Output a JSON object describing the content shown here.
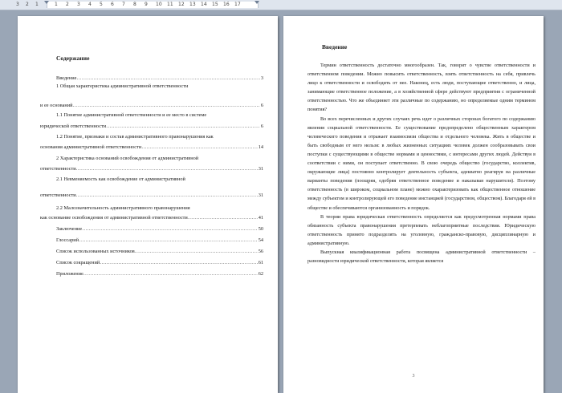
{
  "ruler": {
    "numbers": [
      "3",
      "2",
      "1",
      "1",
      "2",
      "3",
      "4",
      "5",
      "6",
      "7",
      "8",
      "9",
      "10",
      "11",
      "12",
      "13",
      "14",
      "15",
      "16",
      "17"
    ]
  },
  "left_page": {
    "title": "Содержание",
    "toc": [
      {
        "text": "Введение",
        "page": "3"
      },
      {
        "text": "1 Общая характеристика административной ответственности",
        "page": ""
      },
      {
        "text": "и ее оснований",
        "page": "6"
      },
      {
        "text": "1.1 Понятие административной ответственности и ее место в системе",
        "page": ""
      },
      {
        "text": "юридической ответственности",
        "page": "6"
      },
      {
        "text": "1.2 Понятие, признаки и состав административного правонарушения как",
        "page": ""
      },
      {
        "text": "основания административной ответственности",
        "page": "14"
      },
      {
        "text": "2 Характеристика оснований освобождения от административной",
        "page": ""
      },
      {
        "text": "ответственности",
        "page": "31"
      },
      {
        "text": "2.1 Невменяемость как освобождение от административной",
        "page": ""
      },
      {
        "text": "ответственности",
        "page": "31"
      },
      {
        "text": "2.2 Малозначительность административного правонарушения",
        "page": ""
      },
      {
        "text": "как основание освобождения от административной ответственности",
        "page": "41"
      },
      {
        "text": "Заключение",
        "page": "50"
      },
      {
        "text": "Глоссарий",
        "page": "54"
      },
      {
        "text": "Список использованных источников",
        "page": "56"
      },
      {
        "text": "Список сокращений",
        "page": "61"
      },
      {
        "text": "Приложение",
        "page": "62"
      }
    ]
  },
  "right_page": {
    "title": "Введение",
    "paragraphs": [
      "Термин ответственность достаточно многообразен. Так, говорят о чувстве ответственности и ответственном поведении. Можно повысить ответственность, взять ответственность на себя, привлечь лицо к ответственности и освободить от нее. Наконец, есть люди, поступающие ответственно, и лица, занимающие ответственное положение, а в хозяйственной сфере действуют предприятия с ограниченной ответственностью. Что же объединяет эти различные по содержанию, но определяемые одним термином понятия?",
      "Во всех перечисленных и других случаях речь идет о различных сторонах богатого по содержанию явления социальной ответственности. Ее существование предопределено общественным характером человеческого поведения и отражает взаимосвязи общества и отдельного человека. Жить в обществе и быть свободным от него нельзя: в любых жизненных ситуациях человек должен сообразовывать свои поступки с существующими в обществе нормами и ценностями, с интересами других людей. Действуя в соответствии с ними, он поступает ответственно. В свою очередь общество (государство, коллектив, окружающие лица) постоянно контролирует деятельность субъекта, адекватно реагируя на различные варианты поведения (поощряя, одобряя ответственное поведение и наказывая нарушителя). Поэтому ответственность (в широком, социальном плане) можно охарактеризовать как общественное отношение между субъектом и контролирующей его поведение инстанцией (государством, обществом). Благодаря ей в обществе и обеспечиваются организованность и порядок.",
      "В теории права юридическая ответственность определяется как предусмотренная нормами права обязанность субъекта правонарушения претерпевать неблагоприятные последствия. Юридическую ответственность принято подразделять на уголовную, гражданско-правовую, дисциплинарную и административную.",
      "Выпускная квалификационная работа посвящена административной ответственности – разновидности юридической ответственности, которая является"
    ],
    "page_number": "3"
  }
}
